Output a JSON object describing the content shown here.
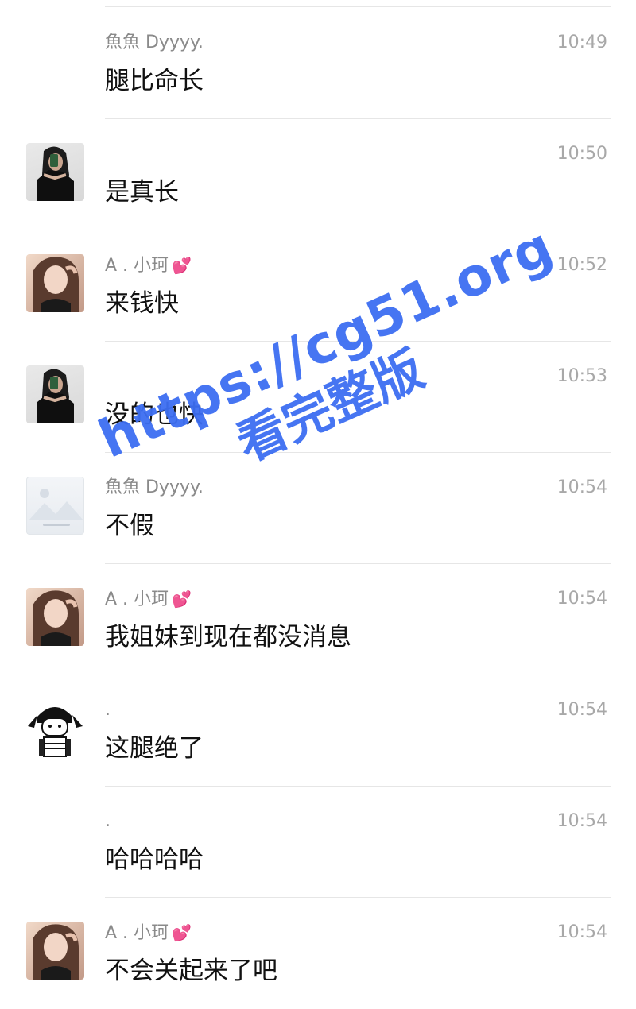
{
  "messages": [
    {
      "sender": "魚魚 Dyyyy.",
      "time": "10:49",
      "text": "腿比命长",
      "avatar": "none",
      "heart": false
    },
    {
      "sender": "",
      "time": "10:50",
      "text": "是真长",
      "avatar": "dark",
      "heart": false
    },
    {
      "sender": "A . 小珂",
      "time": "10:52",
      "text": "来钱快",
      "avatar": "photo",
      "heart": true
    },
    {
      "sender": "",
      "time": "10:53",
      "text": "没的也快",
      "avatar": "dark",
      "heart": false
    },
    {
      "sender": "魚魚 Dyyyy.",
      "time": "10:54",
      "text": "不假",
      "avatar": "placeholder",
      "heart": false
    },
    {
      "sender": "A . 小珂",
      "time": "10:54",
      "text": "我姐妹到现在都没消息",
      "avatar": "photo",
      "heart": true
    },
    {
      "sender": ".",
      "time": "10:54",
      "text": "这腿绝了",
      "avatar": "cartoon",
      "heart": false
    },
    {
      "sender": ".",
      "time": "10:54",
      "text": "哈哈哈哈",
      "avatar": "none",
      "heart": false
    },
    {
      "sender": "A . 小珂",
      "time": "10:54",
      "text": "不会关起来了吧",
      "avatar": "photo",
      "heart": true
    }
  ],
  "heart_icon": "💕",
  "watermark": {
    "url": "https://cg51.org",
    "subtitle": "看完整版",
    "color": "#3d6ef2"
  }
}
